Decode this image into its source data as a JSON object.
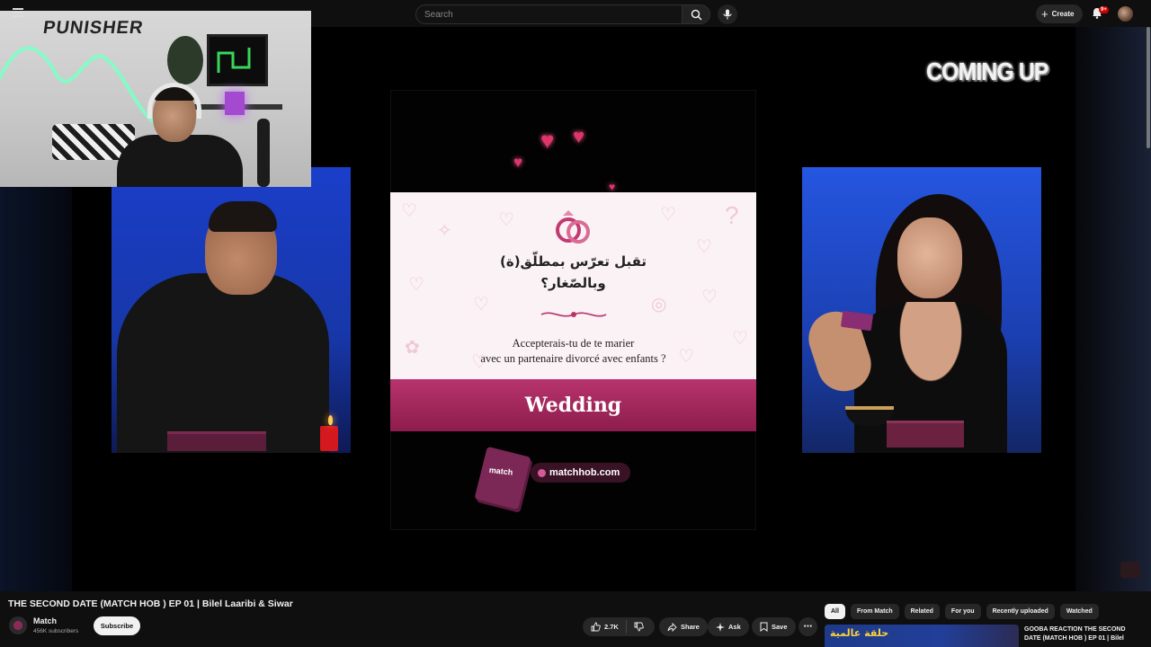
{
  "header": {
    "search_placeholder": "Search",
    "create_label": "Create",
    "notification_count": "9+",
    "icons": [
      "menu-icon",
      "search-icon",
      "mic-icon",
      "plus-icon",
      "bell-icon"
    ]
  },
  "player": {
    "overlay_text": "COMING UP",
    "webcam_logo_text": "PUNISHER",
    "card": {
      "arabic_line1": "تقبل تعرّس بمطلّق(ة)",
      "arabic_line2": "وبالصّغار؟",
      "french_line1": "Accepterais-tu de te marier",
      "french_line2": "avec un partenaire divorcé avec enfants ?",
      "category": "Wedding"
    },
    "deck_label": "match",
    "website": "matchhob.com",
    "colors": {
      "card_bg": "#fbf2f5",
      "category_bar": "#a42a5e",
      "side_panels": "#1a3ec9"
    }
  },
  "video": {
    "title": "THE SECOND DATE (MATCH HOB ) EP 01 | Bilel Laaribi & Siwar",
    "channel_name": "Match",
    "subscribers": "456K subscribers",
    "subscribe_label": "Subscribe",
    "like_count": "2.7K",
    "share_label": "Share",
    "ask_label": "Ask",
    "save_label": "Save"
  },
  "recommendations": {
    "chips": [
      "All",
      "From Match",
      "Related",
      "For you",
      "Recently uploaded",
      "Watched"
    ],
    "active_chip": "All",
    "first": {
      "thumbnail_text": "حلقة عالمية",
      "title": "GOOBA REACTION THE SECOND DATE (MATCH HOB ) EP 01 | Bilel"
    }
  }
}
